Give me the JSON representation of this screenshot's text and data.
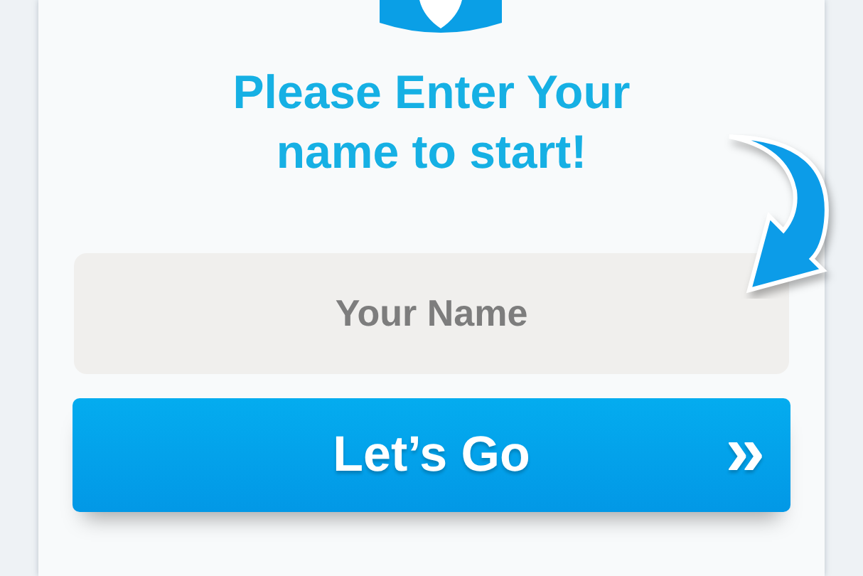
{
  "heading": "Please Enter Your name to start!",
  "name_field": {
    "placeholder": "Your Name"
  },
  "button": {
    "label": "Let’s Go",
    "icon": "»"
  }
}
